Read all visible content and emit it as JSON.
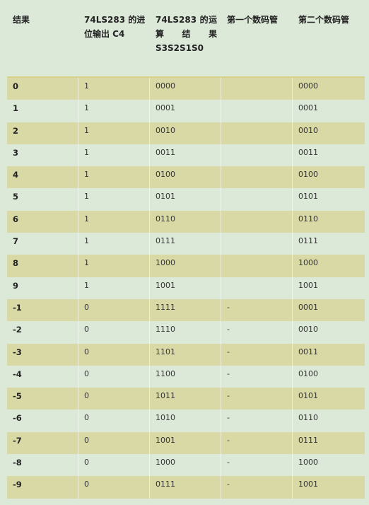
{
  "table": {
    "headers": [
      "结果",
      "74LS283 的进位输出 C4",
      "74LS283 的运算 结 果 S3S2S1S0",
      "第一个数码管",
      "第二个数码管"
    ],
    "rows": [
      [
        "0",
        "1",
        "0000",
        "",
        "0000"
      ],
      [
        "1",
        "1",
        "0001",
        "",
        "0001"
      ],
      [
        "2",
        "1",
        "0010",
        "",
        "0010"
      ],
      [
        "3",
        "1",
        "0011",
        "",
        "0011"
      ],
      [
        "4",
        "1",
        "0100",
        "",
        "0100"
      ],
      [
        "5",
        "1",
        "0101",
        "",
        "0101"
      ],
      [
        "6",
        "1",
        "0110",
        "",
        "0110"
      ],
      [
        "7",
        "1",
        "0111",
        "",
        "0111"
      ],
      [
        "8",
        "1",
        "1000",
        "",
        "1000"
      ],
      [
        "9",
        "1",
        "1001",
        "",
        "1001"
      ],
      [
        "-1",
        "0",
        "1111",
        "-",
        "0001"
      ],
      [
        "-2",
        "0",
        "1110",
        "-",
        "0010"
      ],
      [
        "-3",
        "0",
        "1101",
        "-",
        "0011"
      ],
      [
        "-4",
        "0",
        "1100",
        "-",
        "0100"
      ],
      [
        "-5",
        "0",
        "1011",
        "-",
        "0101"
      ],
      [
        "-6",
        "0",
        "1010",
        "-",
        "0110"
      ],
      [
        "-7",
        "0",
        "1001",
        "-",
        "0111"
      ],
      [
        "-8",
        "0",
        "1000",
        "-",
        "1000"
      ],
      [
        "-9",
        "0",
        "0111",
        "-",
        "1001"
      ]
    ]
  }
}
